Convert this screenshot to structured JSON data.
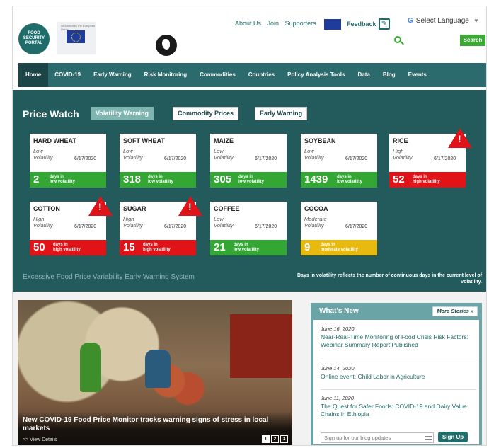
{
  "header": {
    "logo_lines": [
      "FOOD",
      "SECURITY",
      "PORTAL"
    ],
    "eu_caption": "co-funded by the European Union",
    "links": [
      "About Us",
      "Join",
      "Supporters"
    ],
    "feedback": "Feedback",
    "language": "Select Language",
    "search_button": "Search"
  },
  "nav": {
    "items": [
      "Home",
      "COVID-19",
      "Early Warning",
      "Risk Monitoring",
      "Commodities",
      "Countries",
      "Policy Analysis Tools",
      "Data",
      "Blog",
      "Events"
    ]
  },
  "price_watch": {
    "title": "Price Watch",
    "buttons": [
      "Volatility Warning",
      "Commodity Prices",
      "Early Warning"
    ],
    "cards": [
      {
        "name": "HARD WHEAT",
        "level1": "Low",
        "level2": "Volatility",
        "date": "6/17/2020",
        "days": "2",
        "label1": "days in",
        "label2": "low volatility",
        "status": "green",
        "warning": false
      },
      {
        "name": "SOFT WHEAT",
        "level1": "Low",
        "level2": "Volatility",
        "date": "6/17/2020",
        "days": "318",
        "label1": "days in",
        "label2": "low volatility",
        "status": "green",
        "warning": false
      },
      {
        "name": "MAIZE",
        "level1": "Low",
        "level2": "Volatility",
        "date": "6/17/2020",
        "days": "305",
        "label1": "days in",
        "label2": "low volatility",
        "status": "green",
        "warning": false
      },
      {
        "name": "SOYBEAN",
        "level1": "Low",
        "level2": "Volatility",
        "date": "6/17/2020",
        "days": "1439",
        "label1": "days in",
        "label2": "low volatility",
        "status": "green",
        "warning": false
      },
      {
        "name": "RICE",
        "level1": "High",
        "level2": "Volatility",
        "date": "6/17/2020",
        "days": "52",
        "label1": "days in",
        "label2": "high volatility",
        "status": "red",
        "warning": true
      },
      {
        "name": "COTTON",
        "level1": "High",
        "level2": "Volatility",
        "date": "6/17/2020",
        "days": "50",
        "label1": "days in",
        "label2": "high volatility",
        "status": "red",
        "warning": true
      },
      {
        "name": "SUGAR",
        "level1": "High",
        "level2": "Volatility",
        "date": "6/17/2020",
        "days": "15",
        "label1": "days in",
        "label2": "high volatility",
        "status": "red",
        "warning": true
      },
      {
        "name": "COFFEE",
        "level1": "Low",
        "level2": "Volatility",
        "date": "6/17/2020",
        "days": "21",
        "label1": "days in",
        "label2": "low volatility",
        "status": "green",
        "warning": false
      },
      {
        "name": "COCOA",
        "level1": "Moderate",
        "level2": "Volatility",
        "date": "6/17/2020",
        "days": "9",
        "label1": "days in",
        "label2": "moderate volatility",
        "status": "yellow",
        "warning": false
      }
    ],
    "footer_left": "Excessive Food Price Variability Early Warning System",
    "footer_right": "Days in volatility reflects the number of continuous days in the current level of volatility."
  },
  "hero": {
    "title": "New COVID-19 Food Price Monitor tracks warning signs of stress in local markets",
    "link": ">> View Details",
    "pages": [
      "1",
      "2",
      "3"
    ]
  },
  "whats_new": {
    "title": "What's New",
    "more": "More Stories »",
    "items": [
      {
        "date": "June 16, 2020",
        "title": "Near-Real-Time Monitoring of Food Crisis Risk Factors: Webinar Summary Report Published"
      },
      {
        "date": "June 14, 2020",
        "title": "Online event: Child Labor in Agriculture"
      },
      {
        "date": "June 11, 2020",
        "title": "The Quest for Safer Foods: COVID-19 and Dairy Value Chains in Ethiopia"
      }
    ],
    "signup_placeholder": "Sign up for our blog updates",
    "signup_button": "Sign Up"
  },
  "colors": {
    "teal": "#235a5c",
    "nav": "#2c6b6d",
    "green": "#33a633",
    "red": "#e01418",
    "yellow": "#e8b90e"
  }
}
